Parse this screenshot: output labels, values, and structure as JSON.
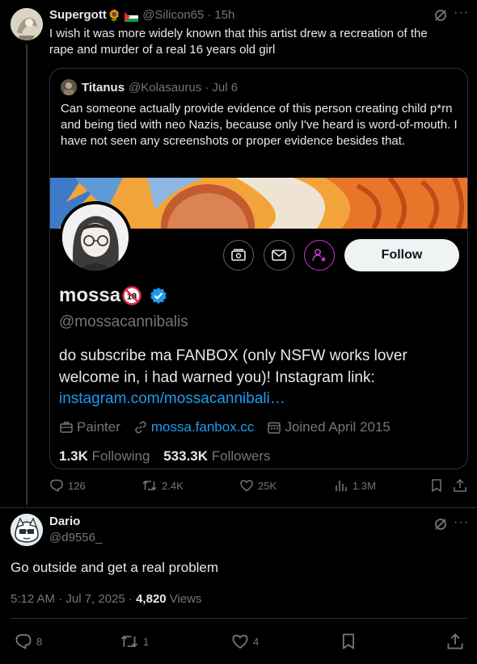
{
  "parent": {
    "name": "Supergott",
    "emoji": "🌻",
    "handle": "@Silicon65",
    "time": "15h",
    "text": "I wish it was more widely known that this artist drew a recreation of the rape and murder of a real 16 years old girl",
    "actions": {
      "replies": "126",
      "reposts": "2.4K",
      "likes": "25K",
      "views": "1.3M"
    }
  },
  "quote": {
    "name": "Titanus",
    "handle": "@Kolasaurus",
    "time": "Jul 6",
    "text": "Can someone actually provide evidence of this person creating child p*rn and being tied with neo Nazis, because only I've heard is word-of-mouth. I have not seen any screenshots or proper evidence besides that.",
    "profile": {
      "name": "mossa",
      "badge": "🔞",
      "handle": "@mossacannibalis",
      "follow_label": "Follow",
      "bio": "do subscribe ma FANBOX (only NSFW works lover welcome in, i had warned you)! Instagram link:",
      "bio_link": "instagram.com/mossacannibali…",
      "category": "Painter",
      "website": "mossa.fanbox.cc",
      "joined": "Joined April 2015",
      "following_count": "1.3K",
      "following_label": "Following",
      "followers_count": "533.3K",
      "followers_label": "Followers"
    }
  },
  "reply": {
    "name": "Dario",
    "handle": "@d9556_",
    "text": "Go outside and get a real problem",
    "time": "5:12 AM · Jul 7, 2025 · ",
    "views_count": "4,820",
    "views_label": " Views",
    "actions": {
      "replies": "8",
      "reposts": "1",
      "likes": "4"
    }
  },
  "colors": {
    "accent": "#1d9bf0",
    "muted": "#71767b",
    "text": "#e7e9ea",
    "border": "#2f3336",
    "background": "#000000"
  },
  "icons": [
    "grok-icon",
    "more-icon",
    "reply-icon",
    "repost-icon",
    "like-icon",
    "views-icon",
    "bookmark-icon",
    "share-icon",
    "subscribe-icon",
    "message-icon",
    "affiliate-icon",
    "verified-icon",
    "briefcase-icon",
    "link-icon",
    "calendar-icon"
  ]
}
